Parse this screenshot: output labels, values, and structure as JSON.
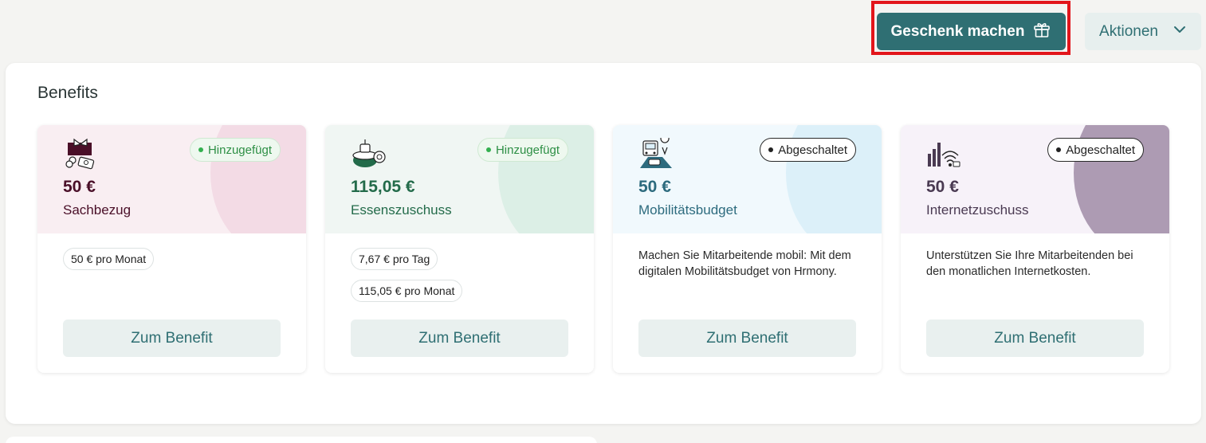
{
  "header": {
    "gift_button_label": "Geschenk machen",
    "gift_icon": "gift-icon",
    "actions_button_label": "Aktionen",
    "actions_icon": "chevron-down-icon"
  },
  "benefits": {
    "title": "Benefits",
    "zum_benefit_label": "Zum Benefit",
    "cards": [
      {
        "amount": "50 €",
        "name": "Sachbezug",
        "status": "Hinzugefügt",
        "status_type": "added",
        "head_bg": "#f9eef2",
        "blob_color": "#f3dbe5",
        "amount_color": "#4a0f28",
        "icon": "voucher-gift-icon",
        "chips": [
          "50 € pro Monat"
        ],
        "description": "",
        "button_label": "Zum Benefit"
      },
      {
        "amount": "115,05 €",
        "name": "Essenszuschuss",
        "status": "Hinzugefügt",
        "status_type": "added",
        "head_bg": "#f0f6f3",
        "blob_color": "#dcefe6",
        "amount_color": "#236b4a",
        "icon": "food-bowl-icon",
        "chips": [
          "7,67 € pro Tag",
          "115,05 € pro Monat"
        ],
        "description": "",
        "button_label": "Zum Benefit"
      },
      {
        "amount": "50 €",
        "name": "Mobilitätsbudget",
        "status": "Abgeschaltet",
        "status_type": "off",
        "head_bg": "#f1f9fd",
        "blob_color": "#dcf0f9",
        "amount_color": "#2d6b7e",
        "icon": "mobility-icon",
        "chips": [],
        "description": "Machen Sie Mitarbeitende mobil: Mit dem digitalen Mobilitätsbudget von Hrmony.",
        "button_label": "Zum Benefit"
      },
      {
        "amount": "50 €",
        "name": "Internetzuschuss",
        "status": "Abgeschaltet",
        "status_type": "off",
        "head_bg": "#f7f2f9",
        "blob_color": "#ad9bb3",
        "amount_color": "#4a3a52",
        "icon": "wifi-icon",
        "chips": [],
        "description": "Unterstützen Sie Ihre Mitarbeitenden bei den monatlichen Internetkosten.",
        "button_label": "Zum Benefit"
      }
    ]
  }
}
